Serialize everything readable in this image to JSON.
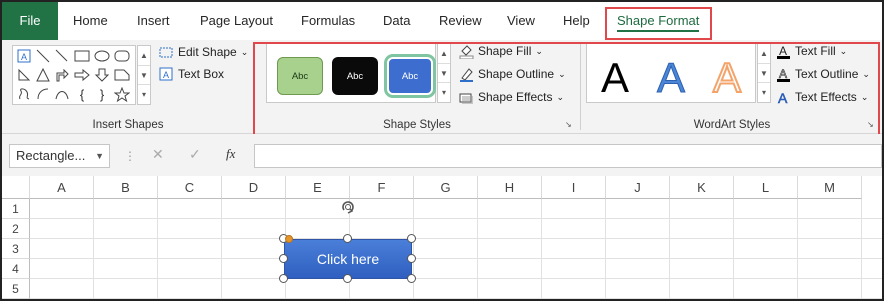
{
  "tabs": [
    "File",
    "Home",
    "Insert",
    "Page Layout",
    "Formulas",
    "Data",
    "Review",
    "View",
    "Help",
    "Shape Format"
  ],
  "active_tab": "Shape Format",
  "colors": {
    "file_tab": "#217346",
    "highlight": "#e0484b",
    "shape_fill": "#3a6bcf",
    "adjust_handle": "#e5962b",
    "underline": "#217346"
  },
  "insert_shapes": {
    "label": "Insert Shapes",
    "edit_shape": "Edit Shape",
    "text_box": "Text Box"
  },
  "shape_styles": {
    "label": "Shape Styles",
    "swatch_text": "Abc",
    "swatches": [
      {
        "style": "green-intense",
        "fill": "#a9d18e",
        "text": "#1a3a12",
        "selected": false
      },
      {
        "style": "black-intense",
        "fill": "#0a0a0a",
        "text": "#ffffff",
        "selected": false
      },
      {
        "style": "blue-intense",
        "fill": "#3c6dcf",
        "text": "#ffffff",
        "selected": true
      }
    ],
    "fill": "Shape Fill",
    "outline": "Shape Outline",
    "effects": "Shape Effects"
  },
  "wordart_styles": {
    "label": "WordArt Styles",
    "letter": "A",
    "styles": [
      {
        "style": "black-solid",
        "color": "#000000"
      },
      {
        "style": "blue-gradient",
        "color": "#4a86d6"
      },
      {
        "style": "orange-outline",
        "color": "#f4a36a"
      }
    ],
    "text_fill": "Text Fill",
    "text_outline": "Text Outline",
    "text_effects": "Text Effects"
  },
  "formula_bar": {
    "name_box": "Rectangle...",
    "fx": "fx",
    "cancel": "✕",
    "enter": "✓"
  },
  "grid": {
    "columns": [
      "A",
      "B",
      "C",
      "D",
      "E",
      "F",
      "G",
      "H",
      "I",
      "J",
      "K",
      "L",
      "M"
    ],
    "rows": [
      "1",
      "2",
      "3",
      "4",
      "5"
    ]
  },
  "shape": {
    "text": "Click here"
  }
}
